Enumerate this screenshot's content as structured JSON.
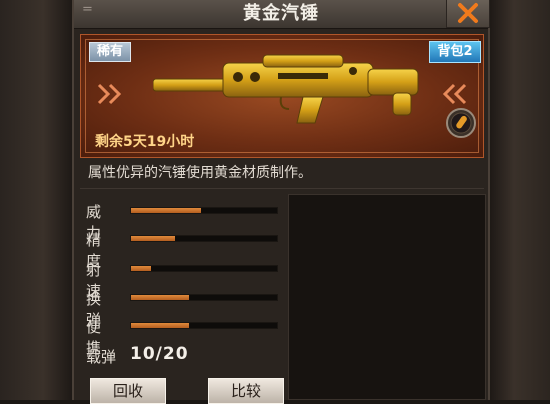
{
  "window": {
    "title": "黄金汽锤",
    "corner_mark": "="
  },
  "card": {
    "rarity": "稀有",
    "bag_slot": "背包2",
    "time_remaining": "剩余5天19小时",
    "accent_color": "#d4a017"
  },
  "description": "属性优异的汽锤使用黄金材质制作。",
  "stats": [
    {
      "label": "威力",
      "value": 0.48
    },
    {
      "label": "精度",
      "value": 0.3
    },
    {
      "label": "射速",
      "value": 0.14
    },
    {
      "label": "换弹",
      "value": 0.4
    },
    {
      "label": "便携",
      "value": 0.4
    }
  ],
  "ammo": {
    "label": "载弹",
    "value": "10/20"
  },
  "buttons": {
    "recycle": "回收",
    "compare": "比较"
  },
  "icons": {
    "close": "close-x-icon",
    "ammo": "bullet-icon",
    "gun": "golden-shotgun-icon"
  }
}
